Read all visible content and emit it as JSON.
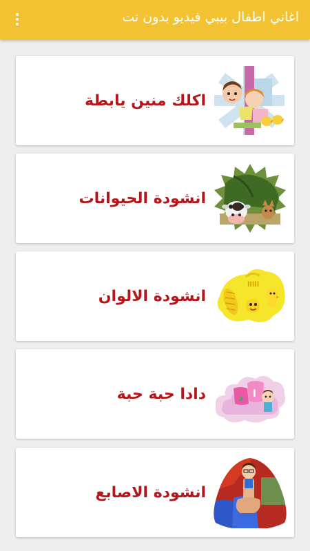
{
  "app": {
    "title": "اغاني اطفال بيبي فيديو بدون نت",
    "menu_icon": "overflow-menu-icon",
    "accent_color": "#f2c232",
    "label_color": "#b5161b"
  },
  "songs": [
    {
      "label": "اكلك منين يابطة",
      "thumb_icon": "kids-duck-thumbnail-icon"
    },
    {
      "label": "انشودة الحيوانات",
      "thumb_icon": "cow-animals-thumbnail-icon"
    },
    {
      "label": "انشودة الالوان",
      "thumb_icon": "yellow-color-thumbnail-icon"
    },
    {
      "label": "دادا حبة حبة",
      "thumb_icon": "dada-cloud-thumbnail-icon"
    },
    {
      "label": "انشودة الاصابع",
      "thumb_icon": "finger-puppet-thumbnail-icon"
    }
  ]
}
